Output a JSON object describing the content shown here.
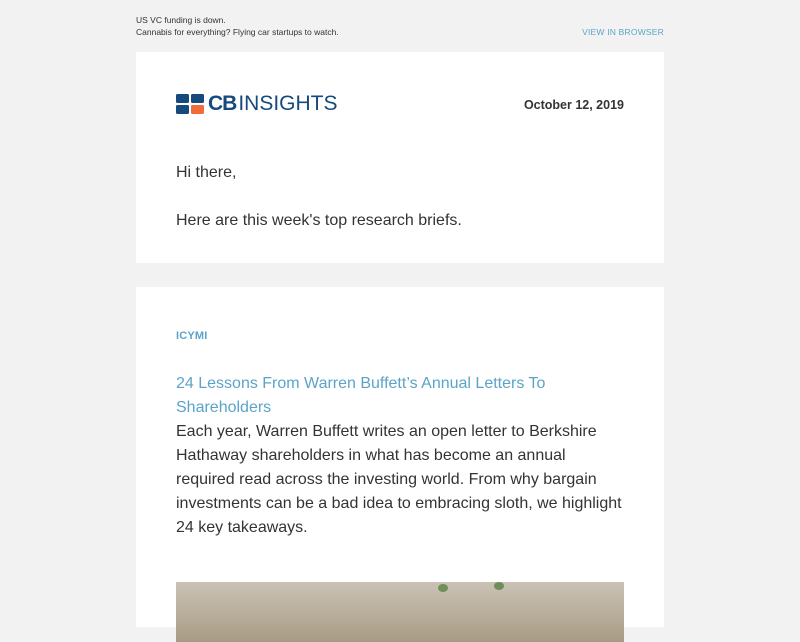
{
  "preheader": {
    "line1": "US VC funding is down.",
    "line2": "Cannabis for everything? Flying car startups to watch.",
    "view_in_browser": "VIEW IN BROWSER"
  },
  "header": {
    "logo_cb": "CB",
    "logo_insights": "INSIGHTS",
    "date": "October 12, 2019",
    "greeting": "Hi there,",
    "intro": "Here are this week's top research briefs."
  },
  "brief": {
    "tag": "ICYMI",
    "title": "24 Lessons From Warren Buffett’s Annual Letters To Shareholders",
    "description": "Each year, Warren Buffett writes an open letter to Berkshire Hathaway shareholders in what has become an annual required read across the investing world. From why bargain investments can be a bad idea to embracing sloth, we highlight 24 key takeaways.",
    "image_icon": "article-photo"
  },
  "colors": {
    "accent": "#5ba4c8",
    "brand_blue": "#174a7c",
    "brand_orange": "#f26b3a",
    "background": "#f2f2f2"
  }
}
